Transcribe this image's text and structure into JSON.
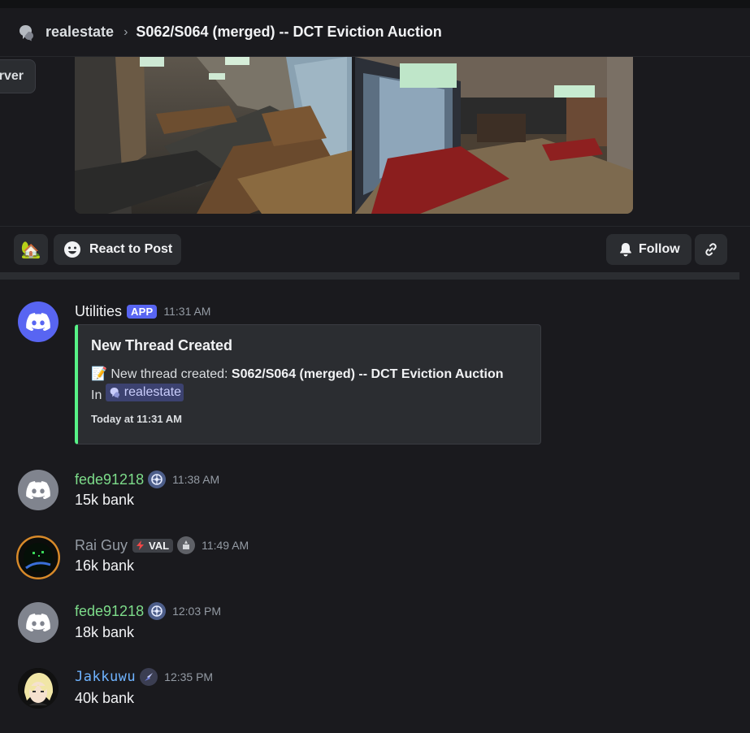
{
  "header": {
    "channel": "realestate",
    "separator": "›",
    "thread_title": "S062/S064 (merged) -- DCT Eviction Auction"
  },
  "tooltip": {
    "text": "rver"
  },
  "actions": {
    "reaction_emoji": "🏡",
    "react_label": "React to Post",
    "follow_label": "Follow"
  },
  "messages": [
    {
      "author": "Utilities",
      "badge": "APP",
      "time": "11:31 AM",
      "name_color": "#f2f3f5",
      "embed": {
        "title": "New Thread Created",
        "desc_emoji": "📝",
        "desc_prefix": "New thread created: ",
        "desc_thread": "S062/S064 (merged) -- DCT Eviction Auction",
        "in_label": "In",
        "channel": "realestate",
        "footer": "Today at 11:31 AM",
        "accent": "#57f287"
      }
    },
    {
      "author": "fede91218",
      "time": "11:38 AM",
      "content": "15k bank",
      "name_color": "#7ddc8a"
    },
    {
      "author": "Rai Guy",
      "guild_tag": "VAL",
      "time": "11:49 AM",
      "content": "16k bank",
      "name_color": "#949ba4"
    },
    {
      "author": "fede91218",
      "time": "12:03 PM",
      "content": "18k bank",
      "name_color": "#7ddc8a"
    },
    {
      "author": "Jakkuwu",
      "time": "12:35 PM",
      "content": "40k bank",
      "name_color": "#6fb3ff"
    }
  ]
}
